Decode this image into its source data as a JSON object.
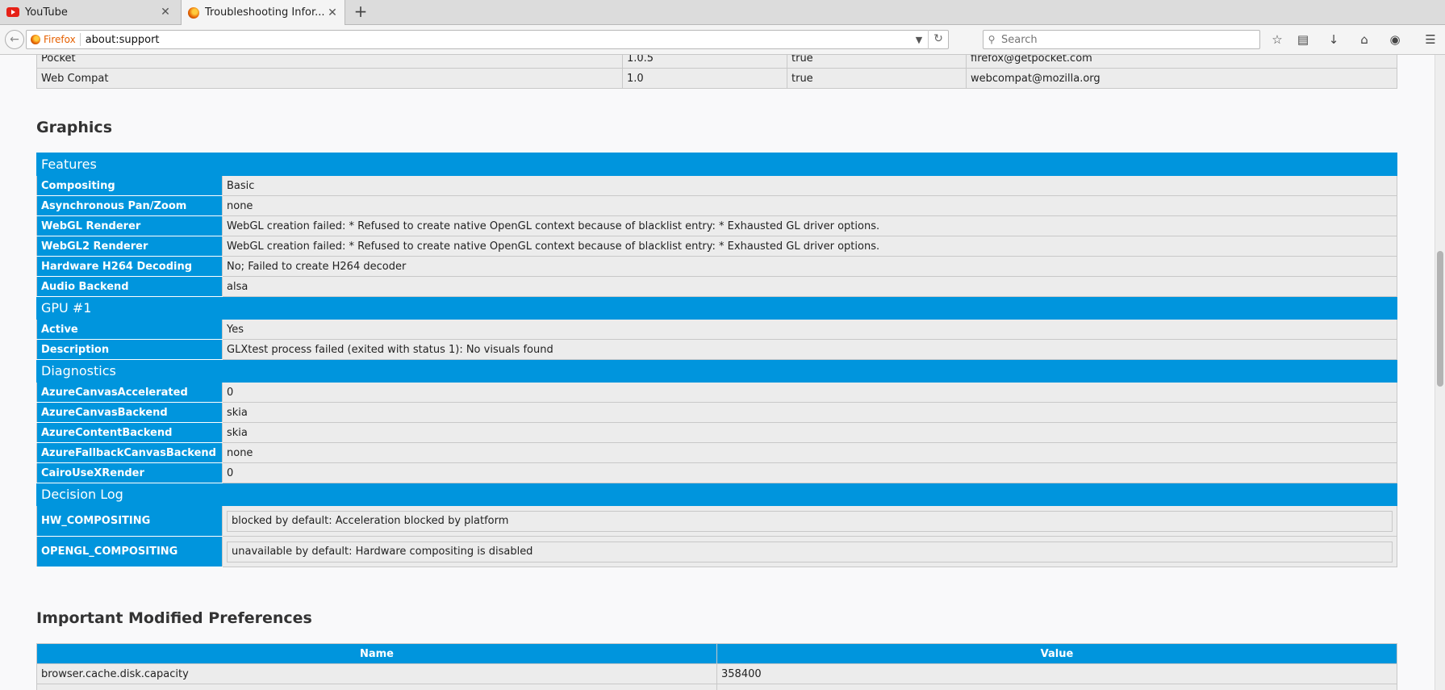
{
  "tabs": [
    {
      "title": "YouTube",
      "icon": "youtube-icon",
      "active": false
    },
    {
      "title": "Troubleshooting Infor...",
      "icon": "firefox-icon",
      "active": true
    }
  ],
  "navbar": {
    "identity_label": "Firefox",
    "url": "about:support",
    "search_placeholder": "Search"
  },
  "addons_tail": [
    {
      "name": "Pocket",
      "version": "1.0.5",
      "enabled": "true",
      "id": "firefox@getpocket.com"
    },
    {
      "name": "Web Compat",
      "version": "1.0",
      "enabled": "true",
      "id": "webcompat@mozilla.org"
    }
  ],
  "graphics": {
    "heading": "Graphics",
    "features": {
      "title": "Features",
      "rows": [
        {
          "key": "Compositing",
          "value": "Basic"
        },
        {
          "key": "Asynchronous Pan/Zoom",
          "value": "none"
        },
        {
          "key": "WebGL Renderer",
          "value": "WebGL creation failed: * Refused to create native OpenGL context because of blacklist entry: * Exhausted GL driver options."
        },
        {
          "key": "WebGL2 Renderer",
          "value": "WebGL creation failed: * Refused to create native OpenGL context because of blacklist entry: * Exhausted GL driver options."
        },
        {
          "key": "Hardware H264 Decoding",
          "value": "No; Failed to create H264 decoder"
        },
        {
          "key": "Audio Backend",
          "value": "alsa"
        }
      ]
    },
    "gpu": {
      "title": "GPU #1",
      "rows": [
        {
          "key": "Active",
          "value": "Yes"
        },
        {
          "key": "Description",
          "value": "GLXtest process failed (exited with status 1): No visuals found"
        }
      ]
    },
    "diagnostics": {
      "title": "Diagnostics",
      "rows": [
        {
          "key": "AzureCanvasAccelerated",
          "value": "0"
        },
        {
          "key": "AzureCanvasBackend",
          "value": "skia"
        },
        {
          "key": "AzureContentBackend",
          "value": "skia"
        },
        {
          "key": "AzureFallbackCanvasBackend",
          "value": "none"
        },
        {
          "key": "CairoUseXRender",
          "value": "0"
        }
      ]
    },
    "decision_log": {
      "title": "Decision Log",
      "rows": [
        {
          "key": "HW_COMPOSITING",
          "value": "blocked by default: Acceleration blocked by platform"
        },
        {
          "key": "OPENGL_COMPOSITING",
          "value": "unavailable by default: Hardware compositing is disabled"
        }
      ]
    }
  },
  "prefs": {
    "heading": "Important Modified Preferences",
    "columns": [
      "Name",
      "Value"
    ],
    "rows": [
      {
        "name": "browser.cache.disk.capacity",
        "value": "358400"
      }
    ]
  }
}
